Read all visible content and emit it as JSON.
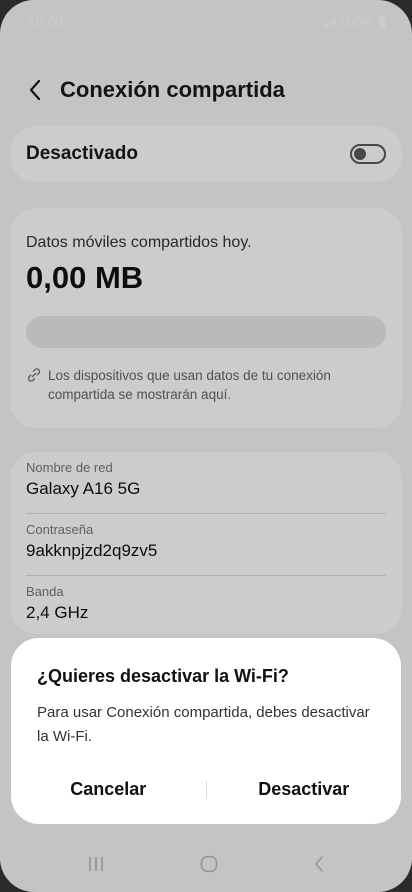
{
  "status_bar": {
    "time": "10:00",
    "battery": "100%",
    "icons": [
      "signal-icon",
      "battery-icon"
    ]
  },
  "header": {
    "title": "Conexión compartida",
    "back_icon": "chevron-left-icon"
  },
  "hotspot_toggle": {
    "label": "Desactivado",
    "enabled": false
  },
  "usage": {
    "caption": "Datos móviles compartidos hoy.",
    "amount": "0,00 MB",
    "fraction_used": 0,
    "info_icon": "link-icon",
    "info_text": "Los dispositivos que usan datos de tu conexión compartida se mostrarán aquí."
  },
  "network": {
    "fields": [
      {
        "label": "Nombre de red",
        "value": "Galaxy A16 5G"
      },
      {
        "label": "Contraseña",
        "value": "9akknpjzd2q9zv5"
      },
      {
        "label": "Banda",
        "value": "2,4 GHz"
      }
    ]
  },
  "dialog": {
    "title": "¿Quieres desactivar la Wi-Fi?",
    "body": "Para usar Conexión compartida, debes desactivar la Wi-Fi.",
    "cancel_label": "Cancelar",
    "confirm_label": "Desactivar"
  },
  "nav_bar": {
    "icons": [
      "recents-icon",
      "home-icon",
      "back-icon"
    ]
  },
  "colors": {
    "background": "#f6f6f6",
    "card": "#ffffff",
    "text_primary": "#1a1a1a",
    "scrim": "rgba(0,0,0,0.20)"
  }
}
